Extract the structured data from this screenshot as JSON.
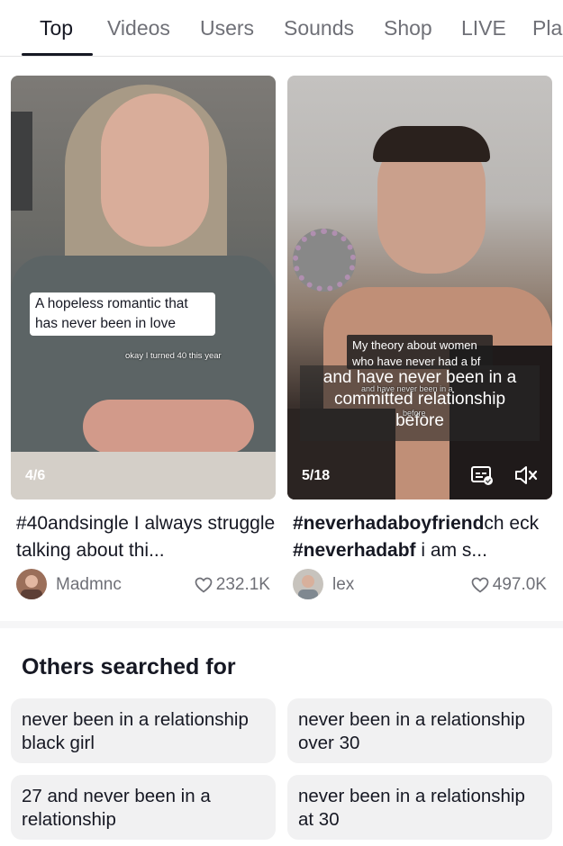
{
  "tabs": [
    {
      "label": "Top"
    },
    {
      "label": "Videos"
    },
    {
      "label": "Users"
    },
    {
      "label": "Sounds"
    },
    {
      "label": "Shop"
    },
    {
      "label": "LIVE"
    },
    {
      "label": "Pla"
    }
  ],
  "videos": [
    {
      "caption": "A hopeless romantic that has never been in love",
      "small_caption": "okay I turned 40 this year",
      "count": "4/6",
      "desc_hashtag": "#40andsingle",
      "desc_rest": " I always struggle talking about thi...",
      "author": "Madmnc",
      "likes": "232.1K"
    },
    {
      "box_caption": "My theory about women who have never had a bf",
      "overlay_line1": "and have never been in a",
      "overlay_line2": "committed relationship",
      "overlay_line3": "before",
      "faint_text": "and have never been in a",
      "faint_text2": "before",
      "count": "5/18",
      "desc_hash1": "#neverhadaboyfriend",
      "desc_mid1": "ch eck ",
      "desc_hash2": "#neverhadabf",
      "desc_rest": " i am s...",
      "author": "lex",
      "likes": "497.0K"
    }
  ],
  "others": {
    "title": "Others searched for",
    "items": [
      "never been in a relationship black girl",
      "never been in a relationship over 30",
      "27 and never been in a relationship",
      "never been in a relationship at 30"
    ]
  },
  "icons": {
    "like": "heart-outline-icon",
    "mute": "speaker-muted-icon",
    "captions": "captions-icon"
  }
}
